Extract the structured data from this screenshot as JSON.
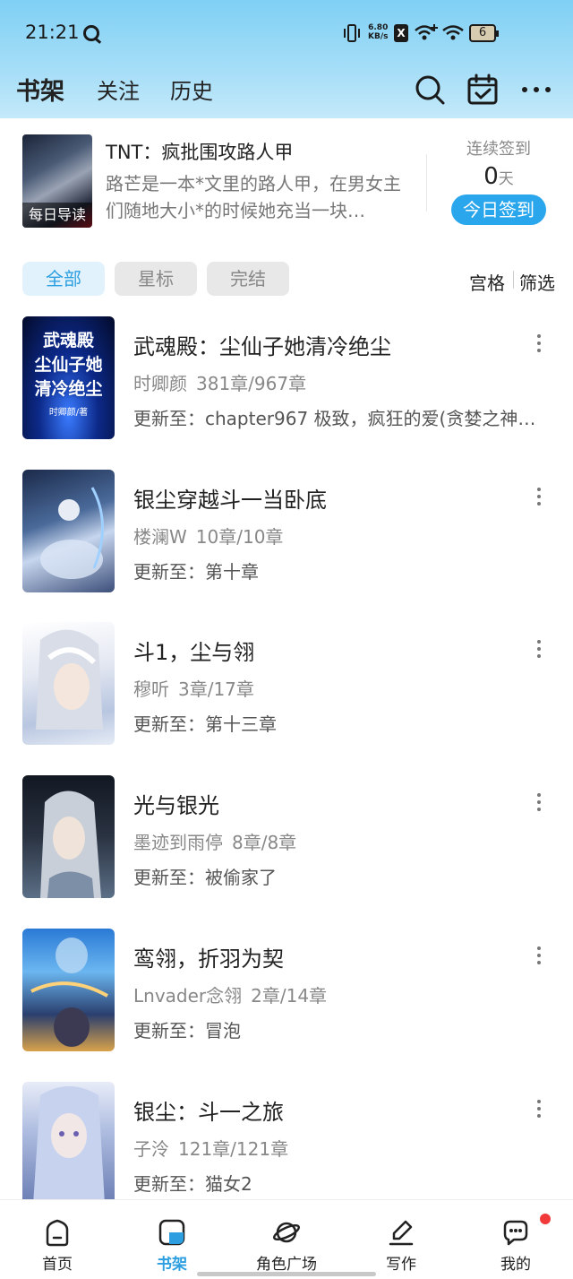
{
  "status_bar": {
    "time": "21:21",
    "net_speed_value": "6.80",
    "net_speed_unit": "KB/s",
    "battery": "6"
  },
  "header": {
    "tabs": [
      {
        "label": "书架",
        "active": true
      },
      {
        "label": "关注",
        "active": false
      },
      {
        "label": "历史",
        "active": false
      }
    ],
    "icons": [
      "search-icon",
      "calendar-icon",
      "more-icon"
    ]
  },
  "daily_reading": {
    "cover_tag": "每日导读",
    "title": "TNT：疯批围攻路人甲",
    "description": "路芒是一本*文里的路人甲，在男女主们随地大小*的时候她充当一块…",
    "sign_label": "连续签到",
    "sign_days": "0",
    "sign_unit": "天",
    "sign_button": "今日签到"
  },
  "filters": {
    "chips": [
      {
        "label": "全部",
        "active": true
      },
      {
        "label": "星标",
        "active": false
      },
      {
        "label": "完结",
        "active": false
      }
    ],
    "grid_label": "宫格",
    "filter_label": "筛选"
  },
  "books": [
    {
      "title": "武魂殿：尘仙子她清冷绝尘",
      "author": "时卿颜",
      "chapters": "381章/967章",
      "update": "更新至：chapter967 极致，疯狂的爱(贪婪之神，…",
      "cover_text": "武魂殿 尘仙子她 清冷绝尘",
      "cover_author": "时卿颜/著"
    },
    {
      "title": "银尘穿越斗一当卧底",
      "author": "楼澜W",
      "chapters": "10章/10章",
      "update": "更新至：第十章"
    },
    {
      "title": "斗1，尘与翎",
      "author": "穆听",
      "chapters": "3章/17章",
      "update": "更新至：第十三章"
    },
    {
      "title": "光与银光",
      "author": "墨迹到雨停",
      "chapters": "8章/8章",
      "update": "更新至：被偷家了"
    },
    {
      "title": "鸾翎，折羽为契",
      "author": "Lnvader念翎",
      "chapters": "2章/14章",
      "update": "更新至：冒泡"
    },
    {
      "title": "银尘：斗一之旅",
      "author": "子泠",
      "chapters": "121章/121章",
      "update": "更新至：猫女2"
    }
  ],
  "bottom_nav": [
    {
      "label": "首页",
      "icon": "home-icon",
      "active": false
    },
    {
      "label": "书架",
      "icon": "bookshelf-icon",
      "active": true
    },
    {
      "label": "角色广场",
      "icon": "planet-icon",
      "active": false
    },
    {
      "label": "写作",
      "icon": "pen-icon",
      "active": false
    },
    {
      "label": "我的",
      "icon": "message-icon",
      "active": false,
      "badge": true
    }
  ],
  "colors": {
    "accent": "#2d9fe0",
    "header_gradient_top": "#7fd0f5",
    "badge": "#f23a3a"
  }
}
